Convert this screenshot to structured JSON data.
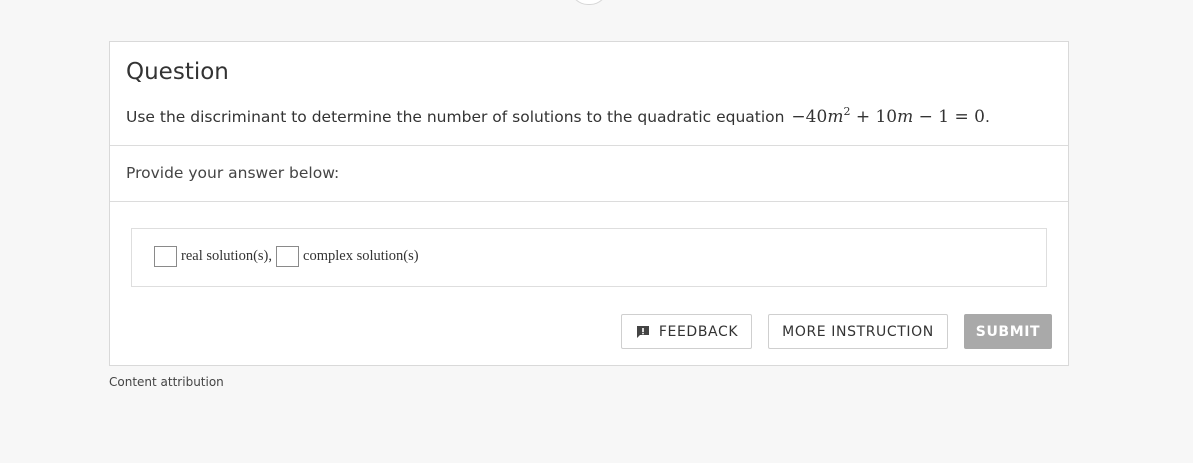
{
  "question": {
    "title": "Question",
    "text": "Use the discriminant to determine the number of solutions to the quadratic equation",
    "equation": {
      "coef1": "−40",
      "var": "m",
      "exp": "2",
      "mid": " + 10",
      "var2": "m",
      "tail": " − 1 = 0",
      "period": "."
    }
  },
  "prompt": "Provide your answer below:",
  "answer": {
    "real_value": "",
    "real_label": "real solution(s),",
    "complex_value": "",
    "complex_label": "complex solution(s)"
  },
  "buttons": {
    "feedback": "FEEDBACK",
    "more_instruction": "MORE INSTRUCTION",
    "submit": "SUBMIT"
  },
  "footer": {
    "attribution": "Content attribution"
  },
  "colors": {
    "submit_bg": "#a9a9a9",
    "page_bg": "#f7f7f7"
  },
  "icons": {
    "feedback": "feedback-icon"
  }
}
